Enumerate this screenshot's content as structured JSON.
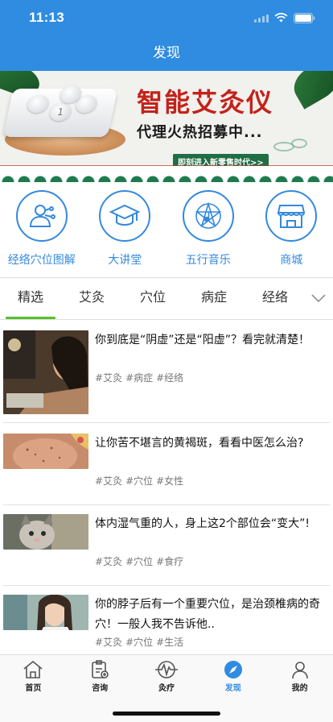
{
  "status_bar": {
    "time": "11:13"
  },
  "nav": {
    "title": "发现"
  },
  "banner": {
    "headline": "智能艾灸仪",
    "subline": "代理火热招募中...",
    "cta": "即刻进入新零售时代>>",
    "device_button_label": "1"
  },
  "quick_entries": [
    {
      "label": "经络穴位图解",
      "icon": "meridian-person-icon"
    },
    {
      "label": "大讲堂",
      "icon": "graduation-cap-icon"
    },
    {
      "label": "五行音乐",
      "icon": "music-star-icon"
    },
    {
      "label": "商城",
      "icon": "store-icon"
    }
  ],
  "tabs": [
    {
      "label": "精选",
      "active": true
    },
    {
      "label": "艾灸",
      "active": false
    },
    {
      "label": "穴位",
      "active": false
    },
    {
      "label": "病症",
      "active": false
    },
    {
      "label": "经络",
      "active": false
    }
  ],
  "articles": [
    {
      "title": "你到底是“阴虚”还是“阳虚”？看完就清楚！",
      "tags": [
        "#艾灸",
        "#病症",
        "#经络"
      ]
    },
    {
      "title": "让你苦不堪言的黄褐斑，看看中医怎么治?",
      "tags": [
        "#艾灸",
        "#穴位",
        "#女性"
      ]
    },
    {
      "title": "体内湿气重的人，身上这2个部位会“变大”!",
      "tags": [
        "#艾灸",
        "#穴位",
        "#食疗"
      ]
    },
    {
      "title": "你的脖子后有一个重要穴位，是治颈椎病的奇穴！一般人我不告诉他..",
      "tags": [
        "#艾灸",
        "#穴位",
        "#生活"
      ]
    }
  ],
  "tabbar": [
    {
      "label": "首页",
      "icon": "home-icon",
      "active": false
    },
    {
      "label": "咨询",
      "icon": "consult-clipboard-icon",
      "active": false
    },
    {
      "label": "灸疗",
      "icon": "pulse-icon",
      "active": false
    },
    {
      "label": "发现",
      "icon": "compass-icon",
      "active": true
    },
    {
      "label": "我的",
      "icon": "person-icon",
      "active": false
    }
  ],
  "colors": {
    "primary": "#2f8ce0",
    "tab_indicator": "#56c12c",
    "banner_red": "#c4221b",
    "entry_blue": "#3489dd"
  }
}
